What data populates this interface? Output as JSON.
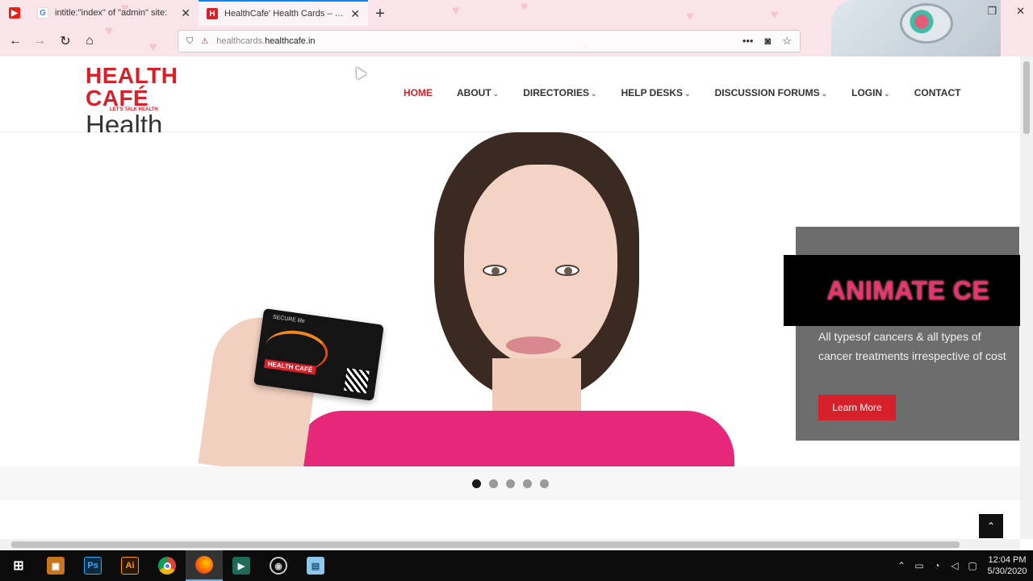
{
  "browser": {
    "tabs": [
      {
        "label": "intitle:\"index\" of \"admin\" site:",
        "favicon": "google-icon"
      },
      {
        "label": "HealthCafe' Health Cards – Be",
        "favicon": "healthcafe-icon"
      }
    ],
    "url_prefix": "healthcards.",
    "url_domain": "healthcafe.in"
  },
  "site": {
    "logo_top": "HEALTH CAFÉ",
    "logo_tagline": "LET'S TALK HEALTH",
    "logo_bottom": "Health Card",
    "nav": [
      {
        "label": "HOME",
        "active": true
      },
      {
        "label": "ABOUT",
        "dropdown": true
      },
      {
        "label": "DIRECTORIES",
        "dropdown": true
      },
      {
        "label": "HELP DESKS",
        "dropdown": true
      },
      {
        "label": "DISCUSSION FORUMS",
        "dropdown": true
      },
      {
        "label": "LOGIN",
        "dropdown": true
      },
      {
        "label": "CONTACT"
      }
    ]
  },
  "hero": {
    "card_secure": "SECURE life",
    "card_logo": "HEALTH CAFÉ",
    "info_text": "All typesof cancers & all types of cancer treatments irrespective of cost",
    "learn_more": "Learn More",
    "overlay": "ANIMATE CE",
    "slides": 5,
    "active_slide": 1
  },
  "taskbar": {
    "apps": [
      "windows-start",
      "photo-viewer",
      "photoshop",
      "illustrator",
      "chrome",
      "firefox",
      "media-app",
      "obs",
      "notes-app"
    ],
    "app_labels": {
      "photoshop": "Ps",
      "illustrator": "Ai"
    },
    "time": "12:04 PM",
    "date": "5/30/2020"
  },
  "colors": {
    "accent": "#d6202a",
    "shirt": "#e7287a",
    "overlay_text": "#e8346a"
  }
}
